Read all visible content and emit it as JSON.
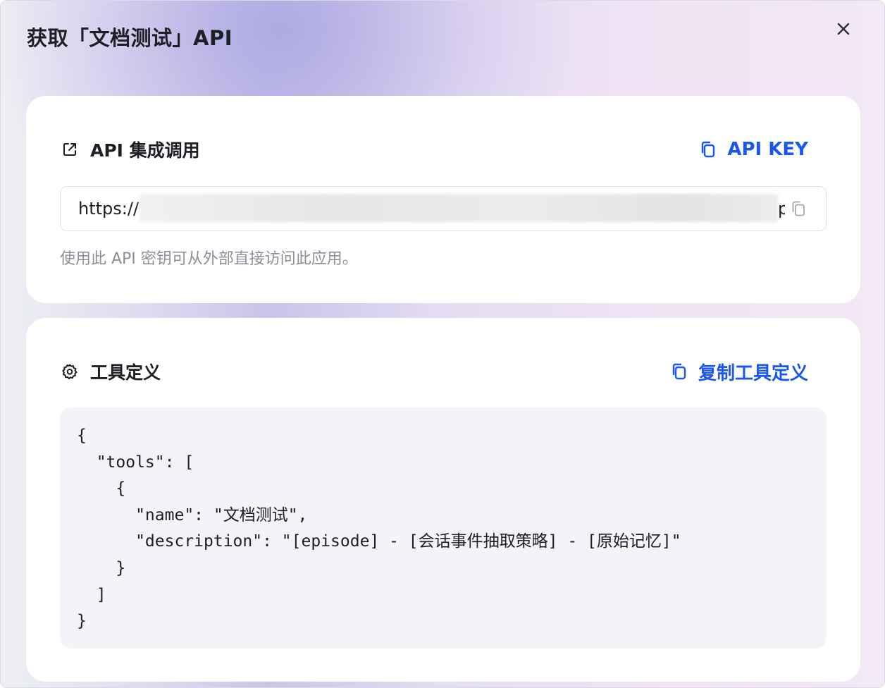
{
  "modal": {
    "title": "获取「文档测试」API"
  },
  "api_section": {
    "title": "API 集成调用",
    "copy_label": "API KEY",
    "url_prefix": "https://",
    "url_tail": "p",
    "hint": "使用此 API 密钥可从外部直接访问此应用。"
  },
  "tool_section": {
    "title": "工具定义",
    "copy_label": "复制工具定义",
    "code": "{\n  \"tools\": [\n    {\n      \"name\": \"文档测试\",\n      \"description\": \"[episode] - [会话事件抽取策略] - [原始记忆]\"\n    }\n  ]\n}"
  },
  "colors": {
    "accent": "#1a56f0",
    "title_text": "#1d1f24",
    "hint_text": "#8a8f99",
    "code_bg": "#f3f4f7"
  },
  "icons": {
    "close": "close-icon",
    "external_link": "external-link-icon",
    "copy": "copy-icon",
    "gear": "gear-icon"
  }
}
